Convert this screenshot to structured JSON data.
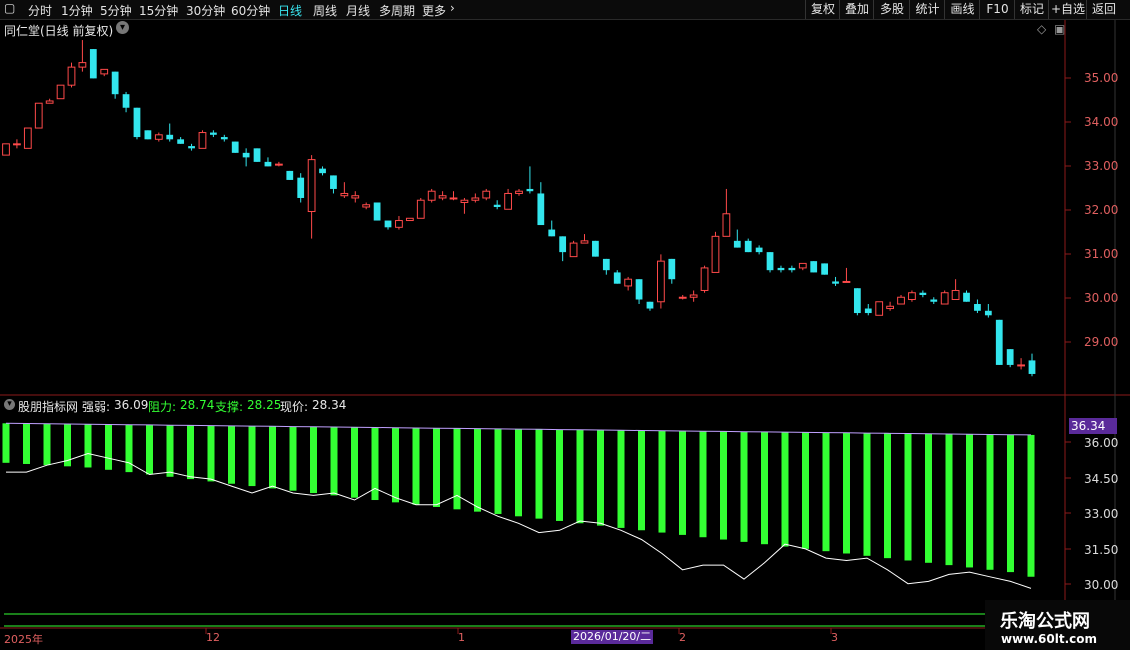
{
  "toolbar": {
    "periods": [
      "分时",
      "1分钟",
      "5分钟",
      "15分钟",
      "30分钟",
      "60分钟",
      "日线",
      "周线",
      "月线",
      "多周期",
      "更多"
    ],
    "active": "日线",
    "right_buttons": [
      "复权",
      "叠加",
      "多股",
      "统计",
      "画线",
      "F10",
      "标记",
      "+自选",
      "返回"
    ]
  },
  "main_chart": {
    "title": "同仁堂(日线 前复权)",
    "right_axis": [
      "35.00",
      "34.00",
      "33.00",
      "32.00",
      "31.00",
      "30.00",
      "29.00"
    ]
  },
  "indicator": {
    "name": "股朋指标网",
    "strength_label": "强弱:",
    "strength_value": "36.09",
    "resistance_label": "阻力:",
    "resistance_value": "28.74",
    "support_label": "支撑:",
    "support_value": "28.25",
    "price_label": "现价:",
    "price_value": "28.34",
    "current_tag": "36.34",
    "right_axis": [
      "36.00",
      "34.50",
      "33.00",
      "31.50",
      "30.00"
    ]
  },
  "date_axis": {
    "labels": [
      "2025年",
      "12",
      "1",
      "2",
      "3"
    ],
    "highlight": "2026/01/20/二"
  },
  "watermark": {
    "line1": "乐淘公式网",
    "line2": "www.60lt.com"
  },
  "colors": {
    "up": "#ff4a4a",
    "down": "#33e6ee",
    "bar": "#33ff33",
    "line": "#ffffff",
    "accent": "#5a2a9a"
  },
  "chart_data": {
    "type": "candlestick",
    "unit": "price",
    "candles_ohlc": [
      [
        33.25,
        33.5,
        33.25,
        33.5
      ],
      [
        33.5,
        33.6,
        33.4,
        33.5
      ],
      [
        33.4,
        33.85,
        33.4,
        33.85
      ],
      [
        33.85,
        34.4,
        33.85,
        34.4
      ],
      [
        34.4,
        34.5,
        34.4,
        34.45
      ],
      [
        34.5,
        34.8,
        34.5,
        34.8
      ],
      [
        34.8,
        35.3,
        34.75,
        35.2
      ],
      [
        35.2,
        35.8,
        35.1,
        35.3
      ],
      [
        35.6,
        35.6,
        34.95,
        34.95
      ],
      [
        35.05,
        35.15,
        35.0,
        35.15
      ],
      [
        35.1,
        35.1,
        34.5,
        34.6
      ],
      [
        34.6,
        34.65,
        34.2,
        34.3
      ],
      [
        34.3,
        34.3,
        33.6,
        33.65
      ],
      [
        33.8,
        33.8,
        33.6,
        33.6
      ],
      [
        33.6,
        33.75,
        33.55,
        33.7
      ],
      [
        33.7,
        33.95,
        33.55,
        33.6
      ],
      [
        33.6,
        33.65,
        33.5,
        33.5
      ],
      [
        33.45,
        33.5,
        33.35,
        33.4
      ],
      [
        33.4,
        33.8,
        33.4,
        33.75
      ],
      [
        33.75,
        33.8,
        33.65,
        33.7
      ],
      [
        33.65,
        33.7,
        33.55,
        33.6
      ],
      [
        33.55,
        33.55,
        33.3,
        33.3
      ],
      [
        33.3,
        33.4,
        33.0,
        33.2
      ],
      [
        33.4,
        33.4,
        33.1,
        33.1
      ],
      [
        33.1,
        33.2,
        33.0,
        33.0
      ],
      [
        33.05,
        33.1,
        33.0,
        33.05
      ],
      [
        32.9,
        32.9,
        32.7,
        32.7
      ],
      [
        32.75,
        32.85,
        32.2,
        32.3
      ],
      [
        32.0,
        33.25,
        31.4,
        33.15
      ],
      [
        32.95,
        33.0,
        32.8,
        32.85
      ],
      [
        32.8,
        32.8,
        32.4,
        32.5
      ],
      [
        32.35,
        32.65,
        32.3,
        32.4
      ],
      [
        32.3,
        32.45,
        32.2,
        32.35
      ],
      [
        32.1,
        32.2,
        32.05,
        32.15
      ],
      [
        32.2,
        32.2,
        31.8,
        31.8
      ],
      [
        31.8,
        31.8,
        31.6,
        31.65
      ],
      [
        31.65,
        31.9,
        31.6,
        31.8
      ],
      [
        31.8,
        31.8,
        31.8,
        31.85
      ],
      [
        31.85,
        32.3,
        31.85,
        32.25
      ],
      [
        32.25,
        32.5,
        32.2,
        32.45
      ],
      [
        32.3,
        32.45,
        32.25,
        32.35
      ],
      [
        32.3,
        32.45,
        32.25,
        32.3
      ],
      [
        32.2,
        32.3,
        31.95,
        32.25
      ],
      [
        32.25,
        32.4,
        32.2,
        32.3
      ],
      [
        32.3,
        32.5,
        32.25,
        32.45
      ],
      [
        32.15,
        32.25,
        32.05,
        32.1
      ],
      [
        32.05,
        32.5,
        32.05,
        32.4
      ],
      [
        32.4,
        32.5,
        32.35,
        32.45
      ],
      [
        32.5,
        33.0,
        32.4,
        32.45
      ],
      [
        32.4,
        32.65,
        31.75,
        31.7
      ],
      [
        31.6,
        31.8,
        31.45,
        31.45
      ],
      [
        31.45,
        31.45,
        30.9,
        31.1
      ],
      [
        31.0,
        31.35,
        31.0,
        31.3
      ],
      [
        31.3,
        31.5,
        31.3,
        31.35
      ],
      [
        31.35,
        31.35,
        31.0,
        31.0
      ],
      [
        30.95,
        30.95,
        30.6,
        30.7
      ],
      [
        30.65,
        30.7,
        30.4,
        30.4
      ],
      [
        30.35,
        30.55,
        30.25,
        30.5
      ],
      [
        30.5,
        30.5,
        29.95,
        30.05
      ],
      [
        30.0,
        30.0,
        29.8,
        29.85
      ],
      [
        30.0,
        31.05,
        29.85,
        30.9
      ],
      [
        30.95,
        30.95,
        30.4,
        30.5
      ],
      [
        30.1,
        30.15,
        30.05,
        30.1
      ],
      [
        30.1,
        30.25,
        30.0,
        30.15
      ],
      [
        30.25,
        30.8,
        30.2,
        30.75
      ],
      [
        30.65,
        31.55,
        30.65,
        31.45
      ],
      [
        31.45,
        32.5,
        31.45,
        31.95
      ],
      [
        31.35,
        31.6,
        31.2,
        31.2
      ],
      [
        31.35,
        31.4,
        31.1,
        31.1
      ],
      [
        31.2,
        31.25,
        31.05,
        31.1
      ],
      [
        31.1,
        31.1,
        30.65,
        30.7
      ],
      [
        30.75,
        30.8,
        30.65,
        30.7
      ],
      [
        30.75,
        30.8,
        30.65,
        30.7
      ],
      [
        30.75,
        30.85,
        30.7,
        30.85
      ],
      [
        30.9,
        30.9,
        30.65,
        30.65
      ],
      [
        30.85,
        30.85,
        30.6,
        30.6
      ],
      [
        30.45,
        30.55,
        30.35,
        30.4
      ],
      [
        30.45,
        30.75,
        30.45,
        30.45
      ],
      [
        30.3,
        30.3,
        29.7,
        29.75
      ],
      [
        29.85,
        29.95,
        29.7,
        29.75
      ],
      [
        29.7,
        30.0,
        29.7,
        30.0
      ],
      [
        29.85,
        30.0,
        29.8,
        29.9
      ],
      [
        29.95,
        30.15,
        29.95,
        30.1
      ],
      [
        30.05,
        30.25,
        30.0,
        30.2
      ],
      [
        30.2,
        30.25,
        30.1,
        30.15
      ],
      [
        30.05,
        30.1,
        29.95,
        30.0
      ],
      [
        29.95,
        30.25,
        29.95,
        30.2
      ],
      [
        30.05,
        30.5,
        30.05,
        30.25
      ],
      [
        30.2,
        30.25,
        30.0,
        30.0
      ],
      [
        29.95,
        30.05,
        29.75,
        29.8
      ],
      [
        29.8,
        29.95,
        29.65,
        29.7
      ],
      [
        29.6,
        29.6,
        28.6,
        28.6
      ],
      [
        28.95,
        28.95,
        28.55,
        28.6
      ],
      [
        28.6,
        28.75,
        28.5,
        28.6
      ],
      [
        28.7,
        28.85,
        28.35,
        28.4
      ]
    ],
    "indicator_bars": [
      36.6,
      36.59,
      36.58,
      36.57,
      36.56,
      36.55,
      36.54,
      36.53,
      36.52,
      36.51,
      36.5,
      36.49,
      36.48,
      36.47,
      36.46,
      36.45,
      36.44,
      36.43,
      36.42,
      36.41,
      36.4,
      36.39,
      36.38,
      36.37,
      36.36,
      36.35,
      36.34,
      36.33,
      36.32,
      36.31,
      36.3,
      36.29,
      36.28,
      36.27,
      36.26,
      36.25,
      36.24,
      36.23,
      36.22,
      36.21,
      36.2,
      36.19,
      36.18,
      36.17,
      36.16,
      36.15,
      36.14,
      36.13,
      36.12,
      36.11,
      36.1
    ],
    "indicator_bar_bottoms": [
      34.9,
      34.85,
      34.8,
      34.75,
      34.7,
      34.6,
      34.5,
      34.4,
      34.3,
      34.2,
      34.1,
      34.0,
      33.9,
      33.8,
      33.7,
      33.6,
      33.5,
      33.4,
      33.3,
      33.2,
      33.1,
      33.0,
      32.9,
      32.8,
      32.7,
      32.6,
      32.5,
      32.4,
      32.3,
      32.2,
      32.1,
      32.0,
      31.9,
      31.8,
      31.7,
      31.6,
      31.5,
      31.4,
      31.3,
      31.2,
      31.1,
      31.0,
      30.9,
      30.8,
      30.7,
      30.6,
      30.5,
      30.4,
      30.3,
      30.2,
      30.0
    ],
    "indicator_line": [
      34.5,
      34.5,
      34.8,
      35.0,
      35.3,
      35.1,
      34.9,
      34.4,
      34.5,
      34.3,
      34.2,
      33.9,
      33.6,
      33.9,
      33.6,
      33.5,
      33.6,
      33.3,
      33.8,
      33.4,
      33.1,
      33.1,
      33.5,
      33.0,
      32.6,
      32.3,
      31.9,
      32.0,
      32.4,
      32.3,
      32.0,
      31.6,
      31.0,
      30.3,
      30.5,
      30.5,
      29.9,
      30.6,
      31.4,
      31.2,
      30.8,
      30.7,
      30.8,
      30.3,
      29.7,
      29.8,
      30.1,
      30.2,
      30.0,
      29.8,
      29.5
    ],
    "price_ylim": [
      28.0,
      36.2
    ],
    "indicator_ylim": [
      29.0,
      37.0
    ]
  }
}
